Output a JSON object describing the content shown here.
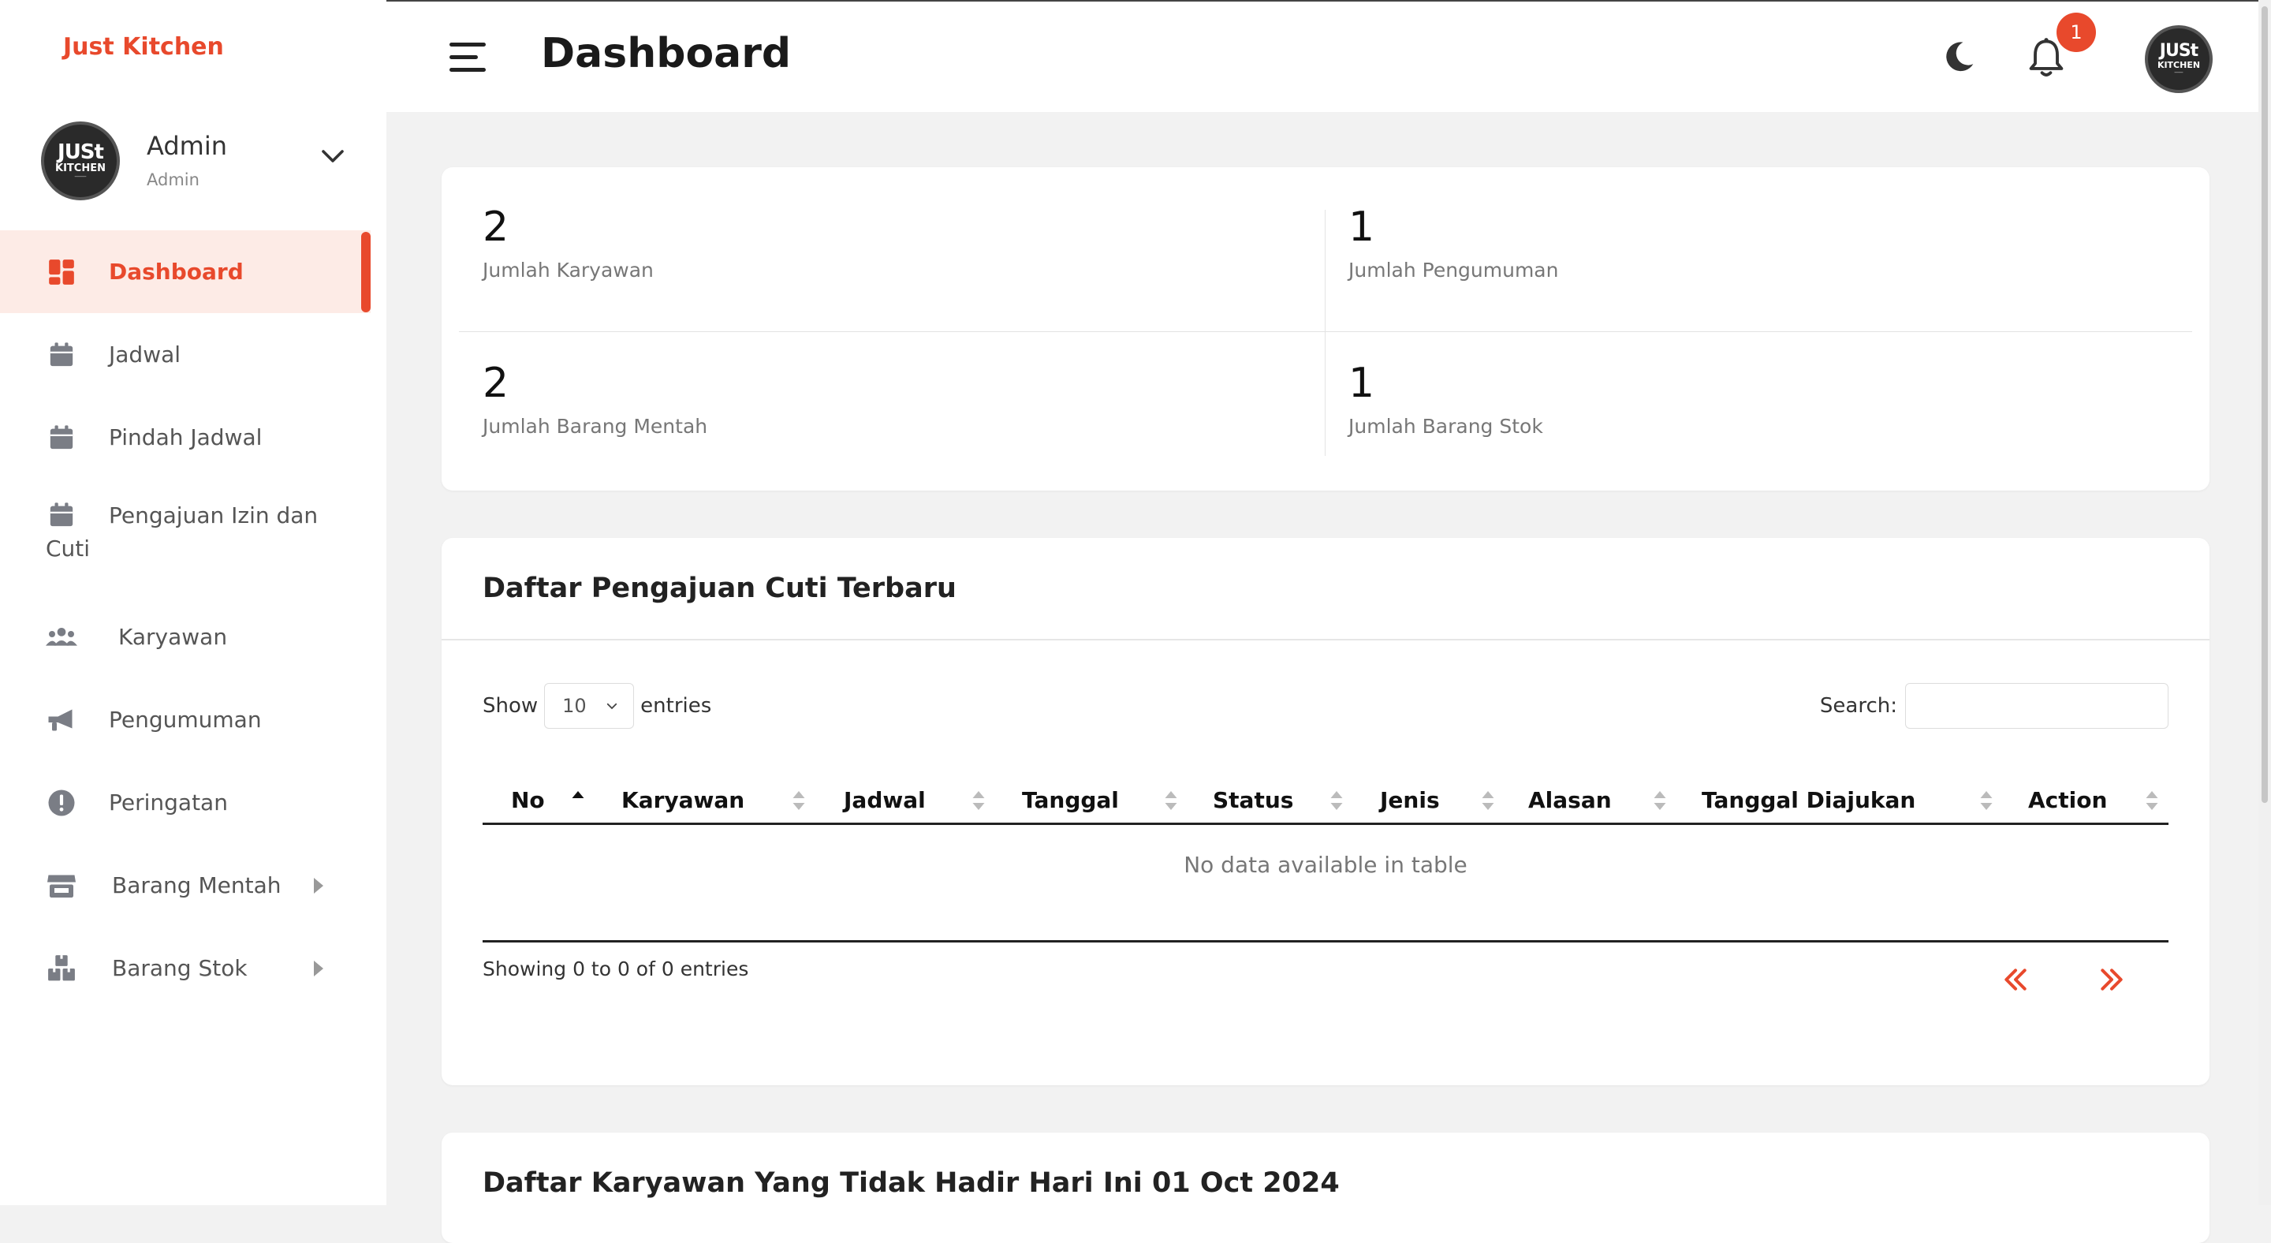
{
  "app": {
    "brand": "Just Kitchen",
    "accent": "#e8492c"
  },
  "user": {
    "name": "Admin",
    "role": "Admin",
    "avatar_text": [
      "JUSt",
      "KITCHEN",
      "THE GEORGIAN & MEDITERRANEAN RESTAURANT"
    ]
  },
  "sidebar": {
    "items": [
      {
        "label": "Dashboard",
        "icon": "dashboard-icon",
        "active": true
      },
      {
        "label": "Jadwal",
        "icon": "calendar-icon"
      },
      {
        "label": "Pindah Jadwal",
        "icon": "calendar-icon"
      },
      {
        "label": "Pengajuan Izin dan Cuti",
        "label_line1": "Pengajuan Izin dan",
        "label_line2": "Cuti",
        "icon": "calendar-icon"
      },
      {
        "label": "Karyawan",
        "icon": "users-icon"
      },
      {
        "label": "Pengumuman",
        "icon": "megaphone-icon"
      },
      {
        "label": "Peringatan",
        "icon": "alert-circle-icon"
      },
      {
        "label": "Barang Mentah",
        "icon": "store-icon",
        "has_submenu": true
      },
      {
        "label": "Barang Stok",
        "icon": "boxes-icon",
        "has_submenu": true
      }
    ]
  },
  "header": {
    "title": "Dashboard",
    "notification_count": "1"
  },
  "stats": [
    {
      "value": "2",
      "label": "Jumlah Karyawan"
    },
    {
      "value": "1",
      "label": "Jumlah Pengumuman"
    },
    {
      "value": "2",
      "label": "Jumlah Barang Mentah"
    },
    {
      "value": "1",
      "label": "Jumlah Barang Stok"
    }
  ],
  "leave_table": {
    "title": "Daftar Pengajuan Cuti Terbaru",
    "show_label": "Show",
    "page_size": "10",
    "entries_label": "entries",
    "search_label": "Search:",
    "search_value": "",
    "columns": [
      "No",
      "Karyawan",
      "Jadwal",
      "Tanggal",
      "Status",
      "Jenis",
      "Alasan",
      "Tanggal Diajukan",
      "Action"
    ],
    "empty_message": "No data available in table",
    "info": "Showing 0 to 0 of 0 entries",
    "prev": "«",
    "next": "»"
  },
  "absent_section": {
    "title": "Daftar Karyawan Yang Tidak Hadir Hari Ini 01 Oct 2024"
  }
}
